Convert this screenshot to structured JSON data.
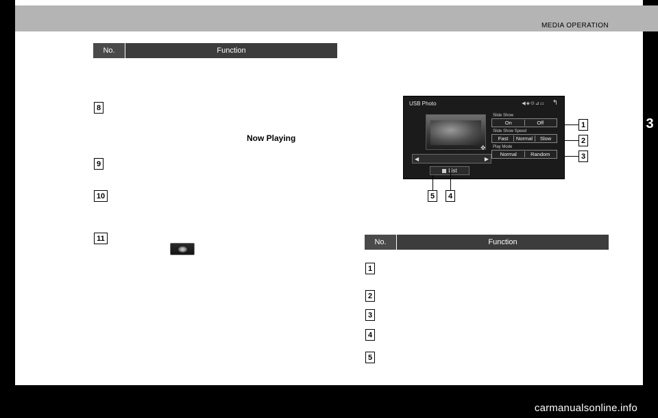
{
  "header": {
    "title": "MEDIA OPERATION",
    "chapter": "3"
  },
  "footer": {
    "watermark": "carmanualsonline.info"
  },
  "tables": {
    "left": {
      "no_header": "No.",
      "function_header": "Function"
    },
    "right": {
      "no_header": "No.",
      "function_header": "Function"
    }
  },
  "left_markers": [
    "8",
    "9",
    "10",
    "11"
  ],
  "right_markers": [
    "1",
    "2",
    "3",
    "4",
    "5"
  ],
  "left_column": {
    "bold_text": "Now Playing",
    "mini_icon_name": "album-art-thumbnail"
  },
  "screenshot": {
    "title": "USB Photo",
    "status_icons": "◀◈⊙⊿⚏",
    "back_icon": "↰",
    "navbar": {
      "prev": "◀",
      "next": "▶"
    },
    "list_button": "List",
    "groups": [
      {
        "label": "Slide Show",
        "buttons": [
          "On",
          "Off"
        ],
        "callout": "1"
      },
      {
        "label": "Slide Show Speed",
        "buttons": [
          "Fast",
          "Normal",
          "Slow"
        ],
        "callout": "2"
      },
      {
        "label": "Play Mode",
        "buttons": [
          "Normal",
          "Random"
        ],
        "callout": "3"
      }
    ],
    "bottom_callouts": [
      "5",
      "4"
    ]
  }
}
